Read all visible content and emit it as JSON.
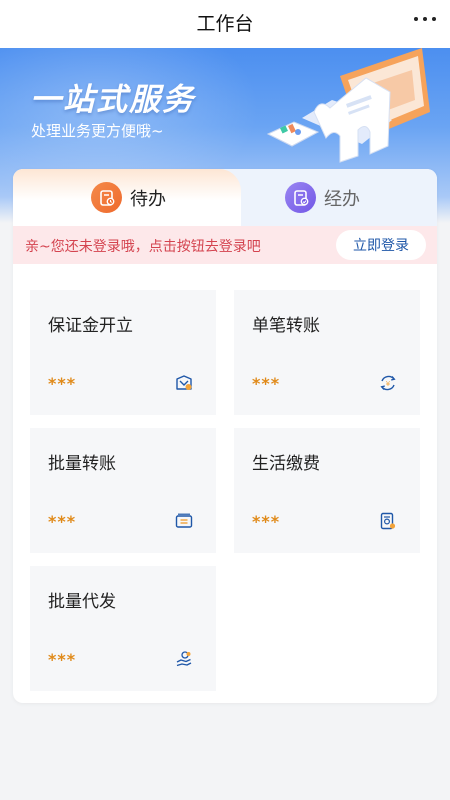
{
  "header": {
    "title": "工作台",
    "more_icon": "more-dots-icon"
  },
  "banner": {
    "title": "一站式服务",
    "subtitle": "处理业务更方便哦~"
  },
  "tabs": [
    {
      "label": "待办",
      "icon": "pending-doc-icon",
      "active": true
    },
    {
      "label": "经办",
      "icon": "handled-doc-icon",
      "active": false
    }
  ],
  "login": {
    "message": "亲~您还未登录哦，点击按钮去登录吧",
    "button_label": "立即登录"
  },
  "services": [
    {
      "name": "保证金开立",
      "value": "***",
      "icon": "deposit-icon"
    },
    {
      "name": "单笔转账",
      "value": "***",
      "icon": "single-transfer-icon"
    },
    {
      "name": "批量转账",
      "value": "***",
      "icon": "batch-transfer-icon"
    },
    {
      "name": "生活缴费",
      "value": "***",
      "icon": "bill-payment-icon"
    },
    {
      "name": "批量代发",
      "value": "***",
      "icon": "batch-payout-icon"
    }
  ],
  "colors": {
    "accent_blue": "#1f57a8",
    "stars_orange": "#e08a1a",
    "warning_red": "#d4434f",
    "pending_orange": "#ef6a2d",
    "handled_purple": "#7257e6"
  }
}
